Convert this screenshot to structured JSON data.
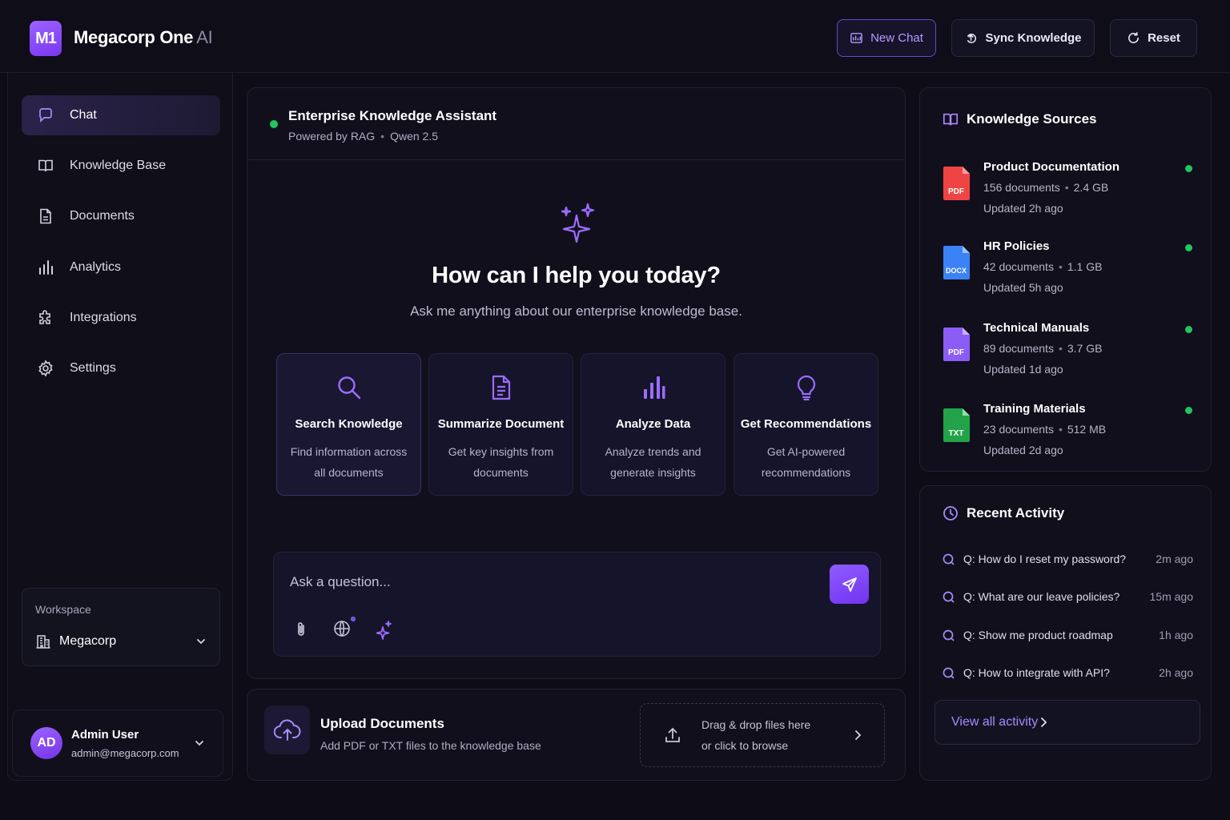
{
  "header": {
    "logo_text": "M1",
    "brand_name": "Megacorp One",
    "brand_suffix": "AI",
    "buttons": {
      "new_chat": "New Chat",
      "sync": "Sync Knowledge",
      "reset": "Reset"
    }
  },
  "sidebar": {
    "items": [
      {
        "label": "Chat",
        "icon": "chat-bubble-icon",
        "active": true
      },
      {
        "label": "Knowledge Base",
        "icon": "book-icon"
      },
      {
        "label": "Documents",
        "icon": "document-icon"
      },
      {
        "label": "Analytics",
        "icon": "bar-chart-icon"
      },
      {
        "label": "Integrations",
        "icon": "puzzle-icon"
      },
      {
        "label": "Settings",
        "icon": "gear-icon"
      }
    ],
    "workspace": {
      "label": "Workspace",
      "value": "Megacorp"
    },
    "user": {
      "initials": "AD",
      "name": "Admin User",
      "email": "admin@megacorp.com"
    }
  },
  "main": {
    "title": "Enterprise Knowledge Assistant",
    "sub_powered": "Powered by RAG",
    "sub_model": "Qwen 2.5",
    "hero_title": "How can I help you today?",
    "hero_sub": "Ask me anything about our enterprise knowledge base.",
    "cards": [
      {
        "title": "Search Knowledge",
        "line1": "Find information across",
        "line2": "all documents",
        "icon": "search-icon"
      },
      {
        "title": "Summarize Document",
        "line1": "Get key insights from",
        "line2": "documents",
        "icon": "document-lines-icon"
      },
      {
        "title": "Analyze Data",
        "line1": "Analyze trends and",
        "line2": "generate insights",
        "icon": "bar-chart-icon"
      },
      {
        "title": "Get Recommendations",
        "line1": "Get AI-powered",
        "line2": "recommendations",
        "icon": "lightbulb-icon"
      }
    ],
    "composer": {
      "placeholder": "Ask a question..."
    }
  },
  "upload": {
    "title": "Upload Documents",
    "subtitle": "Add PDF or TXT files to the knowledge base",
    "drop_line1": "Drag & drop files here",
    "drop_line2": "or click to browse"
  },
  "knowledge_sources": {
    "title": "Knowledge Sources",
    "items": [
      {
        "name": "Product Documentation",
        "docs": "156 documents",
        "size": "2.4 GB",
        "updated": "Updated 2h ago",
        "type": "PDF",
        "color": "#ef4444"
      },
      {
        "name": "HR Policies",
        "docs": "42 documents",
        "size": "1.1 GB",
        "updated": "Updated 5h ago",
        "type": "DOCX",
        "color": "#3b82f6"
      },
      {
        "name": "Technical Manuals",
        "docs": "89 documents",
        "size": "3.7 GB",
        "updated": "Updated 1d ago",
        "type": "PDF",
        "color": "#8b5cf6"
      },
      {
        "name": "Training Materials",
        "docs": "23 documents",
        "size": "512 MB",
        "updated": "Updated 2d ago",
        "type": "TXT",
        "color": "#22c55e"
      }
    ]
  },
  "recent_activity": {
    "title": "Recent Activity",
    "items": [
      {
        "q": "Q: How do I reset my password?",
        "time": "2m ago"
      },
      {
        "q": "Q: What are our leave policies?",
        "time": "15m ago"
      },
      {
        "q": "Q: Show me product roadmap",
        "time": "1h ago"
      },
      {
        "q": "Q: How to integrate with API?",
        "time": "2h ago"
      }
    ],
    "view_all": "View all activity"
  },
  "colors": {
    "accent": "#8b5cf6",
    "status_online": "#22c55e"
  }
}
